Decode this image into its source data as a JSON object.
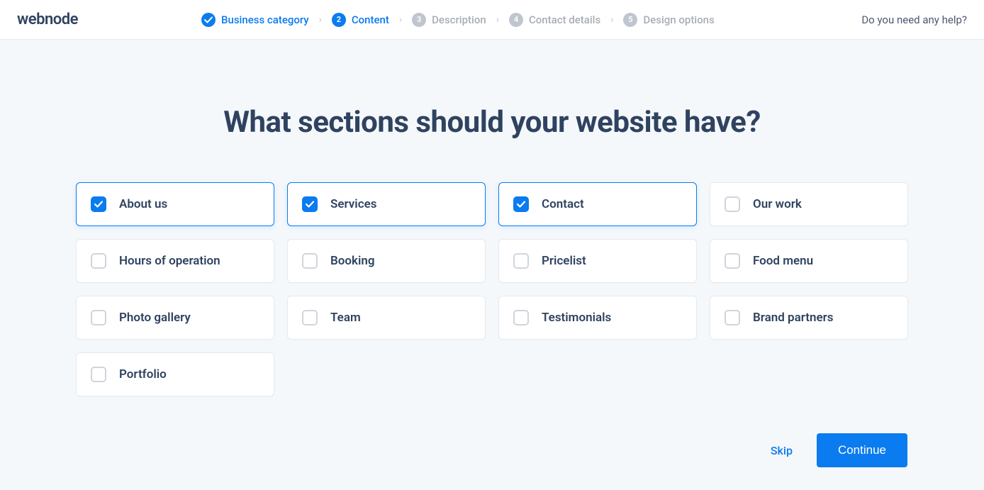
{
  "logo": "webnode",
  "steps": [
    {
      "num": "",
      "label": "Business category",
      "state": "done"
    },
    {
      "num": "2",
      "label": "Content",
      "state": "active"
    },
    {
      "num": "3",
      "label": "Description",
      "state": "pending"
    },
    {
      "num": "4",
      "label": "Contact details",
      "state": "pending"
    },
    {
      "num": "5",
      "label": "Design options",
      "state": "pending"
    }
  ],
  "help_link": "Do you need any help?",
  "heading": "What sections should your website have?",
  "sections": [
    {
      "label": "About us",
      "checked": true
    },
    {
      "label": "Services",
      "checked": true
    },
    {
      "label": "Contact",
      "checked": true
    },
    {
      "label": "Our work",
      "checked": false
    },
    {
      "label": "Hours of operation",
      "checked": false
    },
    {
      "label": "Booking",
      "checked": false
    },
    {
      "label": "Pricelist",
      "checked": false
    },
    {
      "label": "Food menu",
      "checked": false
    },
    {
      "label": "Photo gallery",
      "checked": false
    },
    {
      "label": "Team",
      "checked": false
    },
    {
      "label": "Testimonials",
      "checked": false
    },
    {
      "label": "Brand partners",
      "checked": false
    },
    {
      "label": "Portfolio",
      "checked": false
    }
  ],
  "footer": {
    "skip": "Skip",
    "continue": "Continue"
  }
}
